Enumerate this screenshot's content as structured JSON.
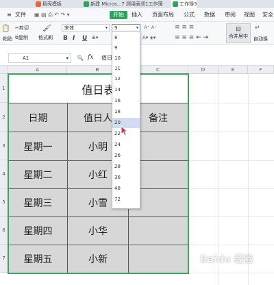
{
  "tabs": [
    {
      "label": "稻壳模板",
      "color": "#e8643c"
    },
    {
      "label": "新建 Micros...7 顾用表须1工作薄",
      "color": "#2ca55c"
    },
    {
      "label": "工作簿3",
      "color": "#2ca55c"
    }
  ],
  "menu": {
    "items": [
      "文件",
      "开始",
      "插入",
      "页面布局",
      "公式",
      "数据",
      "审阅",
      "视图",
      "安全"
    ],
    "active": "开始"
  },
  "ribbon": {
    "cut": "剪切",
    "copy": "复制",
    "format_painter": "格式刷",
    "paste": "粘贴",
    "font_name": "宋体",
    "font_size": "9",
    "bold": "B",
    "italic": "I",
    "underline": "U",
    "merge_center": "合并居中",
    "auto_wrap": "自动换"
  },
  "formula_bar": {
    "cell_ref": "A1",
    "fx": "fx",
    "value": "值日"
  },
  "sheet": {
    "columns": [
      "A",
      "B",
      "C",
      "D",
      "E",
      "F"
    ],
    "rows": [
      "1",
      "2",
      "3",
      "4",
      "5",
      "6",
      "7"
    ],
    "title": "值日表",
    "headers": [
      "日期",
      "值日人",
      "备注"
    ],
    "data": [
      [
        "星期一",
        "小明",
        ""
      ],
      [
        "星期二",
        "小红",
        ""
      ],
      [
        "星期三",
        "小雪",
        ""
      ],
      [
        "星期四",
        "小华",
        ""
      ],
      [
        "星期五",
        "小新",
        ""
      ]
    ]
  },
  "font_size_dropdown": {
    "options": [
      "8",
      "9",
      "10",
      "11",
      "12",
      "14",
      "16",
      "18",
      "20",
      "22",
      "24",
      "26",
      "28",
      "36",
      "48",
      "72"
    ],
    "selected": "20"
  },
  "watermark": "Baidu 经验"
}
